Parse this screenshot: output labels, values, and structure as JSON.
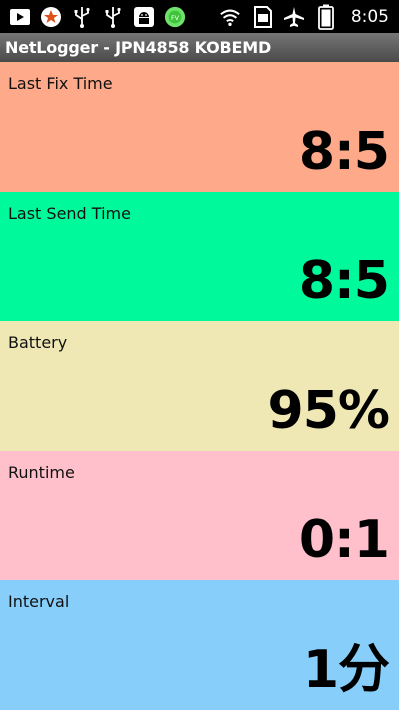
{
  "status_bar": {
    "time": "8:05",
    "icons": [
      "media-icon",
      "star-notification-icon",
      "usb-icon",
      "usb-icon",
      "android-debug-icon",
      "green-badge-icon",
      "wifi-icon",
      "sd-card-icon",
      "airplane-mode-icon",
      "battery-icon"
    ]
  },
  "app": {
    "title": "NetLogger - JPN4858 KOBEMD"
  },
  "panels": [
    {
      "label": "Last Fix Time",
      "value": "8:5",
      "color": "#FFA98B"
    },
    {
      "label": "Last Send Time",
      "value": "8:5",
      "color": "#00F99A"
    },
    {
      "label": "Battery",
      "value": "95%",
      "color": "#EFE8B4"
    },
    {
      "label": "Runtime",
      "value": "0:1",
      "color": "#FFC0CB"
    },
    {
      "label": "Interval",
      "value": "1分",
      "color": "#87CEFA"
    }
  ]
}
